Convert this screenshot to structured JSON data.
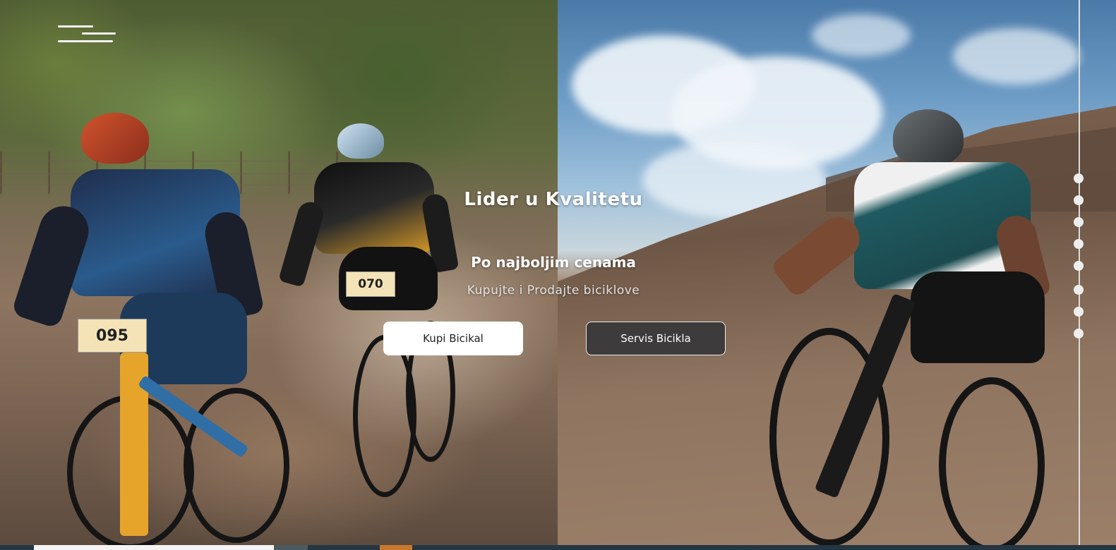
{
  "navigation": {
    "menu_icon": "hamburger-menu-icon"
  },
  "hero": {
    "title": "Lider u Kvalitetu",
    "subtitle": "Po najboljim cenama",
    "tagline": "Kupujte i Prodajte biciklove",
    "buttons": {
      "buy_label": "Kupi Bicikal",
      "service_label": "Servis Bicikla"
    },
    "left_bibs": [
      "095",
      "070"
    ]
  },
  "slider": {
    "dot_count": 8
  },
  "colors": {
    "button_dark": "#3e3b3c",
    "button_light": "#ffffff",
    "bottom_bar": "#243642",
    "accent_orange": "#c8792e"
  }
}
